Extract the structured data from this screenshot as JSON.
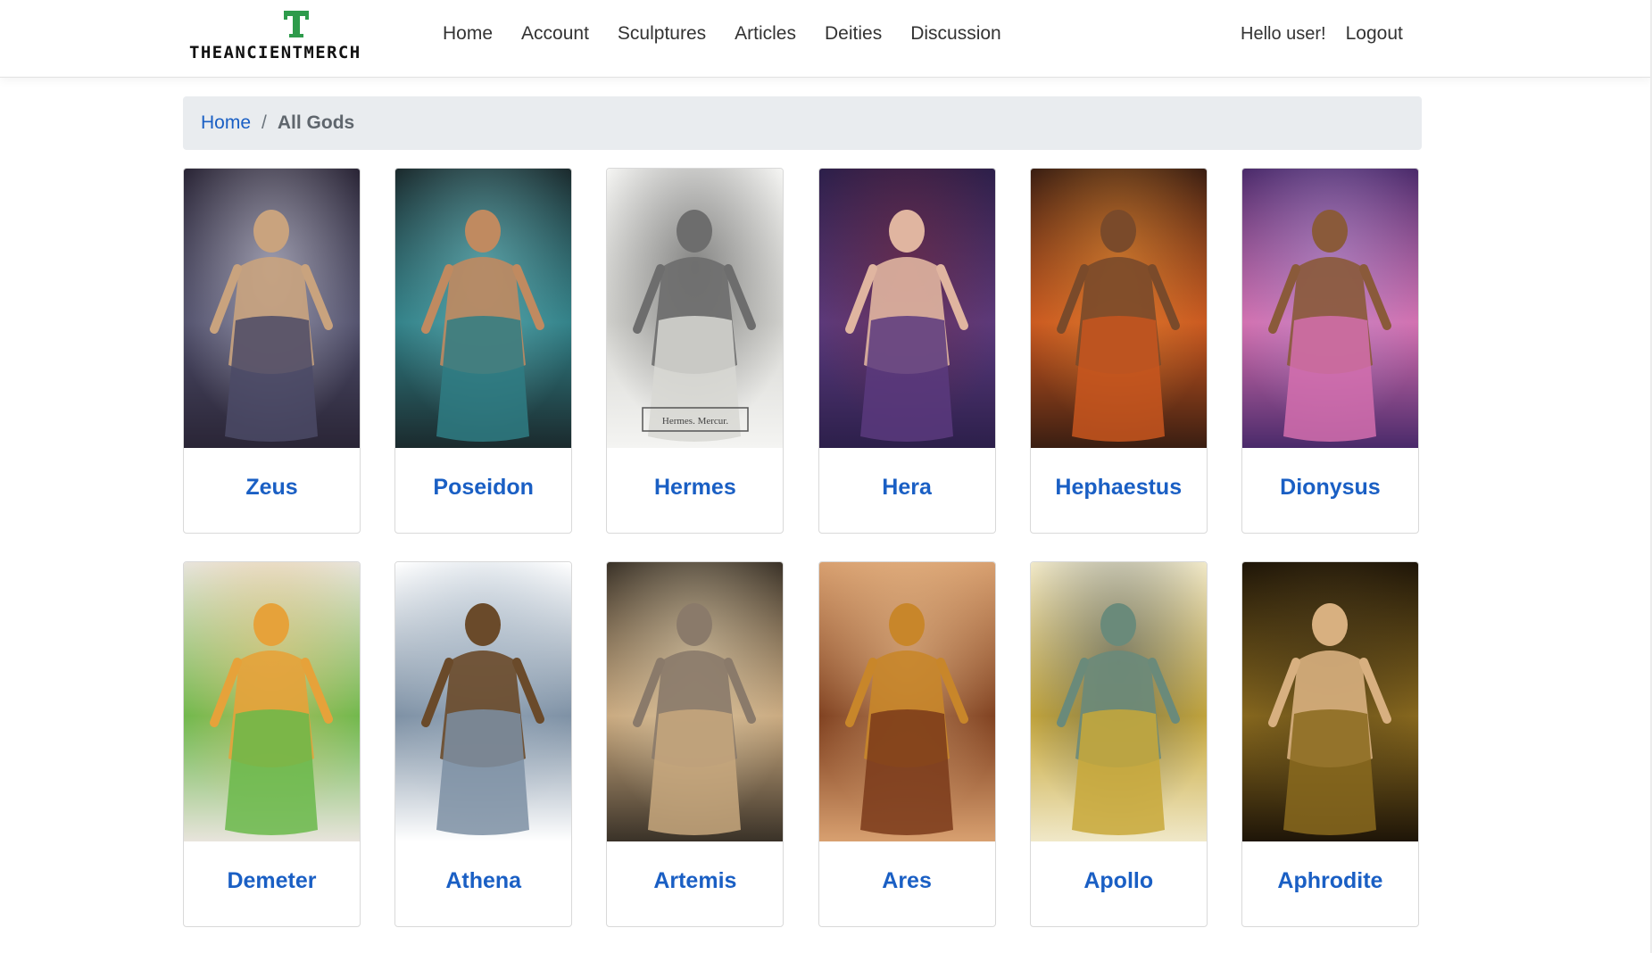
{
  "brand": {
    "logo_letter": "T",
    "name": "THEANCIENTMERCH"
  },
  "nav": {
    "items": [
      "Home",
      "Account",
      "Sculptures",
      "Articles",
      "Deities",
      "Discussion"
    ]
  },
  "user": {
    "greeting": "Hello user!",
    "logout": "Logout"
  },
  "breadcrumb": {
    "home": "Home",
    "separator": "/",
    "current": "All Gods"
  },
  "image_caption_hermes": "Hermes. Mercur.",
  "colors": {
    "link": "#1a5fc4",
    "breadcrumb_bg": "#e9ecef",
    "logo_green": "#2e9b4b"
  },
  "gods": [
    {
      "name": "Zeus",
      "image": "zeus-image",
      "palette": [
        "#2a2536",
        "#4b4a66",
        "#c9a37e",
        "#e8e8f5"
      ]
    },
    {
      "name": "Poseidon",
      "image": "poseidon-image",
      "palette": [
        "#1b2a2d",
        "#2f7d84",
        "#c08a60",
        "#7fd1d6"
      ]
    },
    {
      "name": "Hermes",
      "image": "hermes-image",
      "palette": [
        "#f4f4f2",
        "#d8d8d4",
        "#6d6d6d",
        "#3a3a3a"
      ]
    },
    {
      "name": "Hera",
      "image": "hera-image",
      "palette": [
        "#2c1f4a",
        "#5a3a7e",
        "#e0b5a0",
        "#7a2a3a"
      ]
    },
    {
      "name": "Hephaestus",
      "image": "hephaestus-image",
      "palette": [
        "#3a1e12",
        "#c8561f",
        "#7a4a2a",
        "#f29b3a"
      ]
    },
    {
      "name": "Dionysus",
      "image": "dionysus-image",
      "palette": [
        "#4a2a6a",
        "#d46fae",
        "#8a5a3a",
        "#b79bd9"
      ]
    },
    {
      "name": "Demeter",
      "image": "demeter-image",
      "palette": [
        "#e8e4dc",
        "#6ab84a",
        "#e6a23a",
        "#f1c27a"
      ]
    },
    {
      "name": "Athena",
      "image": "athena-image",
      "palette": [
        "#ffffff",
        "#7c8fa3",
        "#6a4a2a",
        "#a8b8c8"
      ]
    },
    {
      "name": "Artemis",
      "image": "artemis-image",
      "palette": [
        "#3a3228",
        "#c8a87e",
        "#8a7a6a",
        "#e8d8b8"
      ]
    },
    {
      "name": "Ares",
      "image": "ares-image",
      "palette": [
        "#d8a070",
        "#7a3a1a",
        "#c8862a",
        "#f0c898"
      ]
    },
    {
      "name": "Apollo",
      "image": "apollo-image",
      "palette": [
        "#f0e8c8",
        "#c8a83a",
        "#6a8a7a",
        "#3a4a5a"
      ]
    },
    {
      "name": "Aphrodite",
      "image": "aphrodite-image",
      "palette": [
        "#1e1508",
        "#8a6a1e",
        "#d8b080",
        "#4a3a1a"
      ]
    }
  ]
}
